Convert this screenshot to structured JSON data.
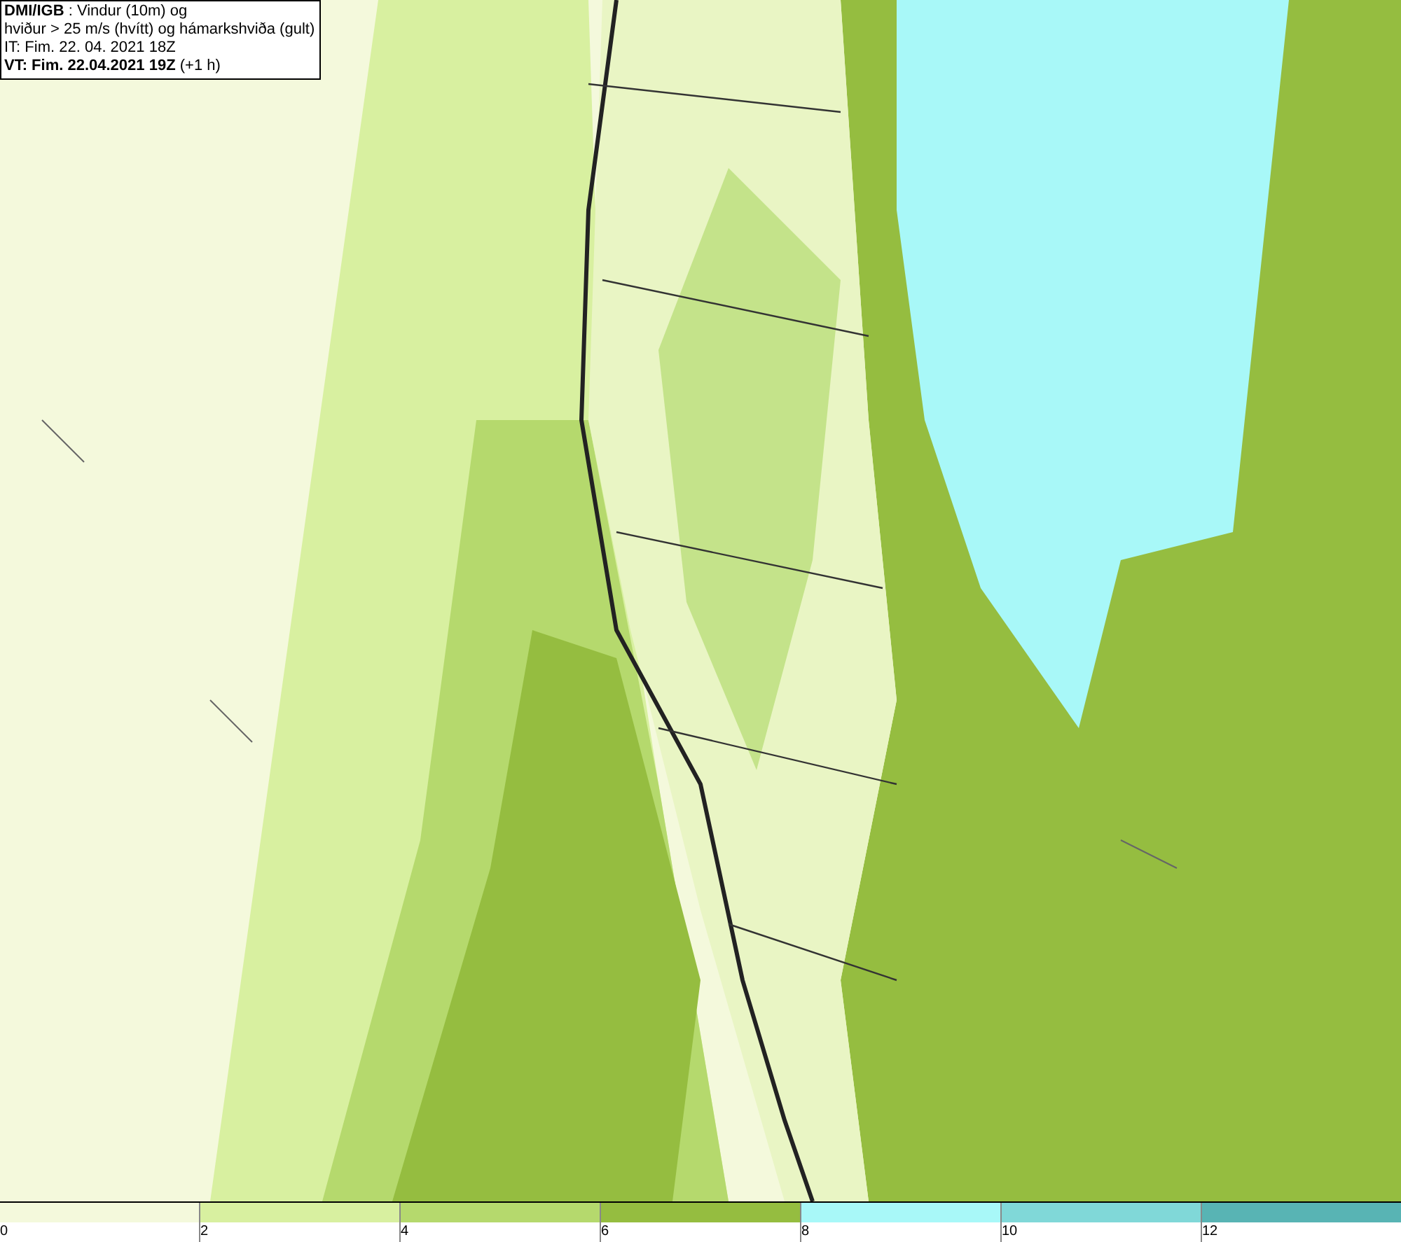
{
  "legend": {
    "lines": [
      "**DMI/IGB** : Vindur (10m) og",
      "hviður > 25 m/s (hvítt) og hámarkshviða (gult)",
      "IT: Fim. 22. 04. 2021 18Z",
      "**VT: Fim. 22.04.2021 19Z** (+1 h)"
    ]
  },
  "color_scale": [
    {
      "label": "0",
      "color": "#f4f9dc"
    },
    {
      "label": "2",
      "color": "#d8f0a0"
    },
    {
      "label": "4",
      "color": "#b5d96d"
    },
    {
      "label": "6",
      "color": "#95bd40"
    },
    {
      "label": "8",
      "color": "#a8f8f8"
    },
    {
      "label": "10",
      "color": "#80d8d8"
    },
    {
      "label": "12",
      "color": "#58b4b4"
    }
  ]
}
